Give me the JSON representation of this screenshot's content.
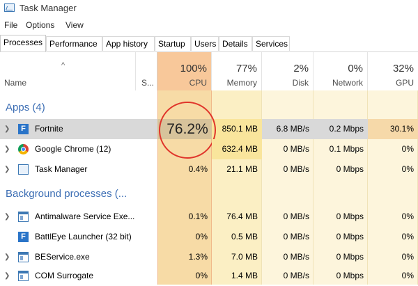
{
  "window": {
    "title": "Task Manager"
  },
  "menu": [
    "File",
    "Options",
    "View"
  ],
  "tabs": [
    "Processes",
    "Performance",
    "App history",
    "Startup",
    "Users",
    "Details",
    "Services"
  ],
  "active_tab": "Processes",
  "columns": {
    "name": "Name",
    "status": "S...",
    "cpu": {
      "pct": "100%",
      "label": "CPU"
    },
    "memory": {
      "pct": "77%",
      "label": "Memory"
    },
    "disk": {
      "pct": "2%",
      "label": "Disk"
    },
    "network": {
      "pct": "0%",
      "label": "Network"
    },
    "gpu": {
      "pct": "32%",
      "label": "GPU"
    }
  },
  "sort_column": "CPU",
  "groups": {
    "apps": "Apps (4)",
    "background": "Background processes (..."
  },
  "rows": [
    {
      "name": "Fortnite",
      "icon": "fortnite-icon",
      "expand": true,
      "cpu": "76.2%",
      "memory": "850.1 MB",
      "disk": "6.8 MB/s",
      "network": "0.2 Mbps",
      "gpu": "30.1%",
      "selected": true
    },
    {
      "name": "Google Chrome (12)",
      "icon": "chrome-icon",
      "expand": true,
      "cpu": "",
      "memory": "632.4 MB",
      "disk": "0 MB/s",
      "network": "0.1 Mbps",
      "gpu": "0%"
    },
    {
      "name": "Task Manager",
      "icon": "task-manager-icon",
      "expand": true,
      "cpu": "0.4%",
      "memory": "21.1 MB",
      "disk": "0 MB/s",
      "network": "0 Mbps",
      "gpu": "0%"
    },
    {
      "name": "Antimalware Service Exe...",
      "icon": "window-icon",
      "expand": true,
      "cpu": "0.1%",
      "memory": "76.4 MB",
      "disk": "0 MB/s",
      "network": "0 Mbps",
      "gpu": "0%"
    },
    {
      "name": "BattlEye Launcher (32 bit)",
      "icon": "fortnite-icon",
      "expand": false,
      "cpu": "0%",
      "memory": "0.5 MB",
      "disk": "0 MB/s",
      "network": "0 Mbps",
      "gpu": "0%"
    },
    {
      "name": "BEService.exe",
      "icon": "window-icon",
      "expand": true,
      "cpu": "1.3%",
      "memory": "7.0 MB",
      "disk": "0 MB/s",
      "network": "0 Mbps",
      "gpu": "0%"
    },
    {
      "name": "COM Surrogate",
      "icon": "window-icon",
      "expand": true,
      "cpu": "0%",
      "memory": "1.4 MB",
      "disk": "0 MB/s",
      "network": "0 Mbps",
      "gpu": "0%"
    }
  ],
  "highlight": {
    "value": "76.2%",
    "color": "#e0352b"
  },
  "colors": {
    "cpu_column": "#f7dba6",
    "cpu_header": "#f8c89a",
    "memory_column": "#fbefc4",
    "light_column": "#fdf5dc",
    "memory_strong": "#f9e59c",
    "group_title": "#3c6eb4"
  }
}
